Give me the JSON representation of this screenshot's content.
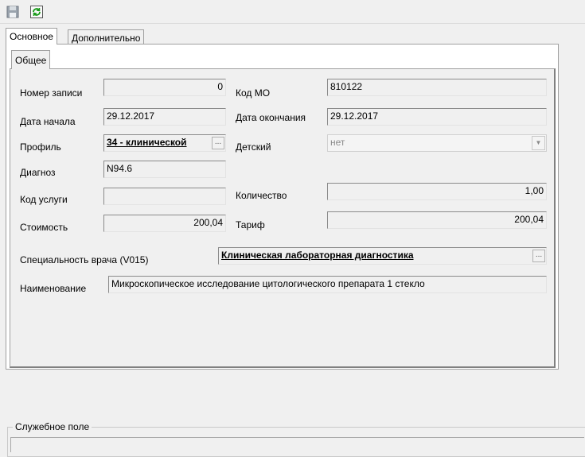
{
  "toolbar": {
    "save_icon": "save-icon",
    "refresh_icon": "refresh-icon"
  },
  "tabs": [
    {
      "label": "Основное"
    },
    {
      "label": "Дополнительно"
    }
  ],
  "subtabs": [
    {
      "label": "Общее"
    }
  ],
  "form": {
    "record_number_label": "Номер записи",
    "record_number_value": "0",
    "mo_code_label": "Код МО",
    "mo_code_value": "810122",
    "start_date_label": "Дата начала",
    "start_date_value": "29.12.2017",
    "end_date_label": "Дата окончания",
    "end_date_value": "29.12.2017",
    "profile_label": "Профиль",
    "profile_value": "34 - клинической",
    "child_label": "Детский",
    "child_value": "нет",
    "diagnosis_label": "Диагноз",
    "diagnosis_value": "N94.6",
    "service_code_label": "Код услуги",
    "service_code_value": "",
    "quantity_label": "Количество",
    "quantity_value": "1,00",
    "cost_label": "Стоимость",
    "cost_value": "200,04",
    "tariff_label": "Тариф",
    "tariff_value": "200,04",
    "specialty_label": "Специальность врача (V015)",
    "specialty_value": "Клиническая лабораторная диагностика",
    "name_label": "Наименование",
    "name_value": "Микроскопическое исследование цитологического препарата 1 стекло",
    "ellipsis": "..."
  },
  "service_field": {
    "legend": "Служебное поле",
    "value": ""
  },
  "colors": {
    "background": "#f0f0f0",
    "border": "#a0a0a0"
  }
}
